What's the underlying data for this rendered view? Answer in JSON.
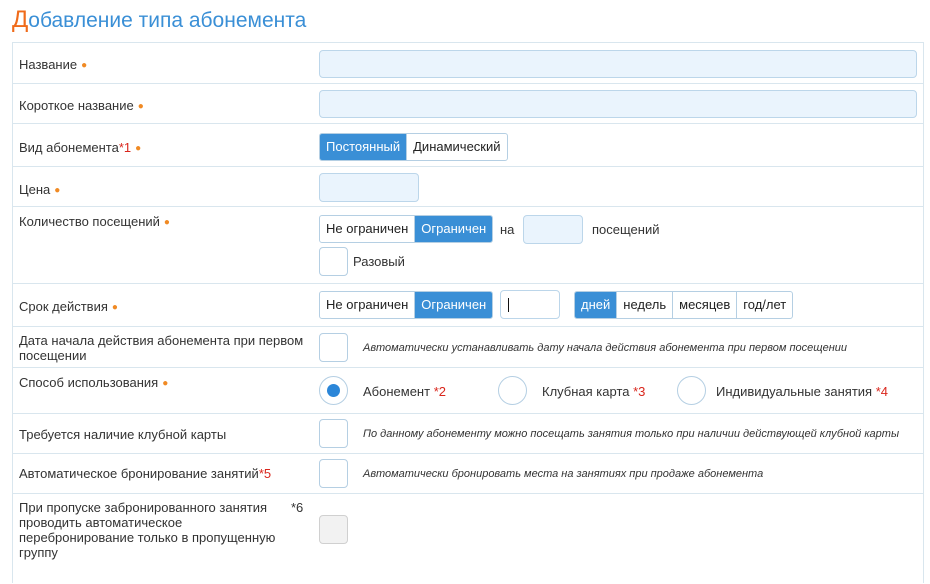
{
  "page": {
    "title_first": "Д",
    "title_rest": "обавление типа абонемента"
  },
  "required_mark": "●",
  "rows": {
    "name": {
      "label": "Название"
    },
    "short_name": {
      "label": "Короткое название"
    },
    "kind": {
      "label": "Вид абонемента",
      "note": "*1",
      "options": [
        "Постоянный",
        "Динамический"
      ],
      "selected": "Постоянный"
    },
    "price": {
      "label": "Цена"
    },
    "visits": {
      "label": "Количество посещений",
      "options": [
        "Не ограничен",
        "Ограничен"
      ],
      "selected": "Ограничен",
      "on_text": "на",
      "unit_text": "посещений",
      "single_label": "Разовый"
    },
    "validity": {
      "label": "Срок действия",
      "options": [
        "Не ограничен",
        "Ограничен"
      ],
      "selected": "Ограничен",
      "unit_options": [
        "дней",
        "недель",
        "месяцев",
        "год/лет"
      ],
      "unit_selected": "дней"
    },
    "start_date": {
      "label": "Дата начала действия абонемента при первом посещении",
      "hint": "Автоматически устанавливать дату начала действия абонемента при первом посещении"
    },
    "usage": {
      "label": "Способ использования",
      "options": [
        {
          "label": "Абонемент",
          "note": "*2",
          "selected": true
        },
        {
          "label": "Клубная карта",
          "note": "*3",
          "selected": false
        },
        {
          "label": "Индивидуальные занятия",
          "note": "*4",
          "selected": false
        }
      ]
    },
    "club_card": {
      "label": "Требуется наличие клубной карты",
      "hint": "По данному абонементу можно посещать занятия только при наличии действующей клубной карты"
    },
    "auto_booking": {
      "label": "Автоматическое бронирование занятий",
      "note": "*5",
      "hint": "Автоматически бронировать места на занятиях при продаже абонемента"
    },
    "rebooking": {
      "label": "При пропуске забронированного занятия проводить автоматическое перебронирование только в пропущенную группу",
      "note": "*6"
    }
  }
}
